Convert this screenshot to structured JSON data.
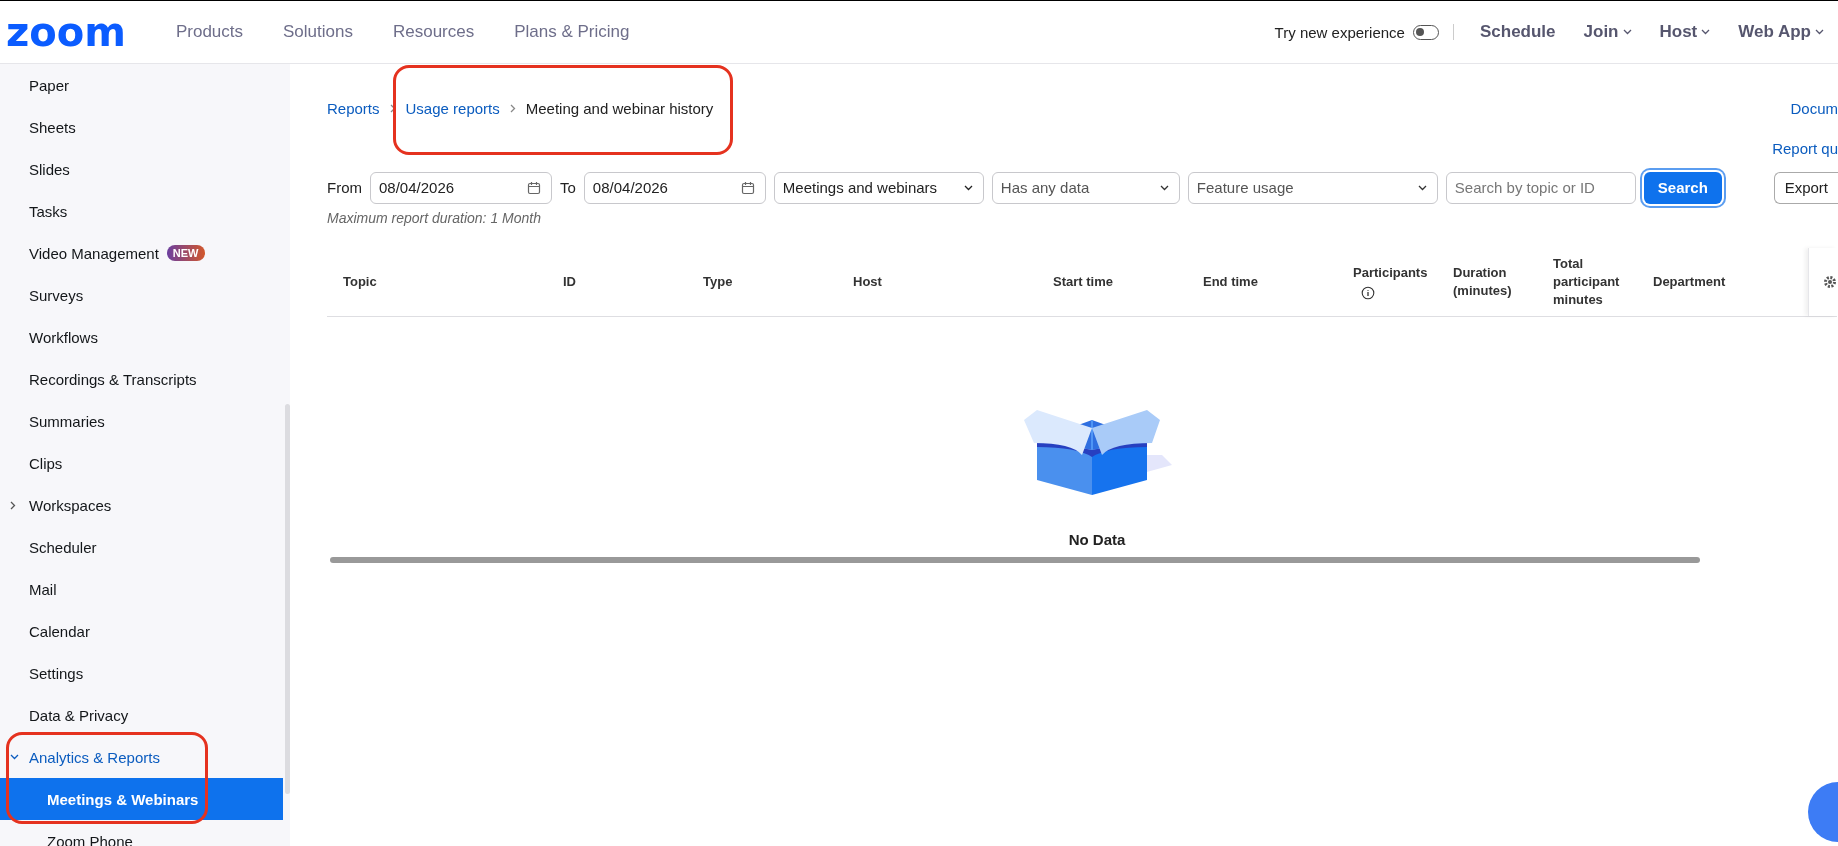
{
  "header": {
    "logo": "zoom",
    "nav": [
      "Products",
      "Solutions",
      "Resources",
      "Plans & Pricing"
    ],
    "toggle": {
      "label": "Try new experience",
      "on": false
    },
    "actions": [
      {
        "label": "Schedule",
        "dropdown": false
      },
      {
        "label": "Join",
        "dropdown": true
      },
      {
        "label": "Host",
        "dropdown": true
      },
      {
        "label": "Web App",
        "dropdown": true
      }
    ]
  },
  "sidebar": {
    "items": [
      {
        "kind": "item",
        "label": "Paper",
        "selected": false
      },
      {
        "kind": "item",
        "label": "Sheets",
        "selected": false
      },
      {
        "kind": "item",
        "label": "Slides",
        "selected": false
      },
      {
        "kind": "item",
        "label": "Tasks",
        "selected": false
      },
      {
        "kind": "item",
        "label": "Video Management",
        "badge": "NEW",
        "selected": false
      },
      {
        "kind": "item",
        "label": "Surveys",
        "selected": false
      },
      {
        "kind": "item",
        "label": "Workflows",
        "selected": false
      },
      {
        "kind": "item",
        "label": "Recordings & Transcripts",
        "selected": false
      },
      {
        "kind": "item",
        "label": "Summaries",
        "selected": false
      },
      {
        "kind": "item",
        "label": "Clips",
        "selected": false
      },
      {
        "kind": "group",
        "label": "Workspaces",
        "expanded": false,
        "selected": false
      },
      {
        "kind": "item",
        "label": "Scheduler",
        "selected": false
      },
      {
        "kind": "item",
        "label": "Mail",
        "selected": false
      },
      {
        "kind": "item",
        "label": "Calendar",
        "selected": false
      },
      {
        "kind": "item",
        "label": "Settings",
        "selected": false
      },
      {
        "kind": "item",
        "label": "Data & Privacy",
        "selected": false
      },
      {
        "kind": "group",
        "label": "Analytics & Reports",
        "expanded": true,
        "selected": false,
        "children": [
          {
            "label": "Meetings & Webinars",
            "selected": true
          },
          {
            "label": "Zoom Phone",
            "selected": false
          }
        ]
      }
    ]
  },
  "breadcrumb": [
    {
      "label": "Reports",
      "link": true
    },
    {
      "label": "Usage reports",
      "link": true
    },
    {
      "label": "Meeting and webinar history",
      "link": false
    }
  ],
  "side_links": [
    "Docum",
    "Report qu"
  ],
  "filters": {
    "from_label": "From",
    "from_value": "08/04/2026",
    "to_label": "To",
    "to_value": "08/04/2026",
    "selects": [
      "Meetings and webinars",
      "Has any data",
      "Feature usage"
    ],
    "search": {
      "placeholder": "Search by topic or ID"
    },
    "search_button": "Search",
    "export_button": "Export",
    "note": "Maximum report duration: 1 Month"
  },
  "table": {
    "columns": [
      {
        "label": "Topic",
        "info": false
      },
      {
        "label": "ID",
        "info": false
      },
      {
        "label": "Type",
        "info": false
      },
      {
        "label": "Host",
        "info": false
      },
      {
        "label": "Start time",
        "info": false
      },
      {
        "label": "End time",
        "info": false
      },
      {
        "label": "Participants",
        "info": true
      },
      {
        "label": "Duration (minutes)",
        "info": false
      },
      {
        "label": "Total participant minutes",
        "info": false
      },
      {
        "label": "Department",
        "info": false
      }
    ],
    "empty_text": "No Data"
  }
}
